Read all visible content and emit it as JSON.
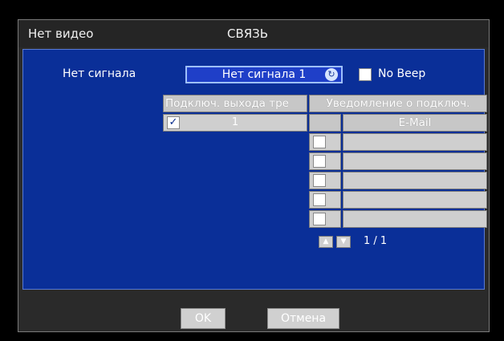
{
  "header": {
    "left_title": "Нет видео",
    "center_title": "СВЯЗЬ"
  },
  "signal": {
    "label": "Нет сигнала",
    "select_value": "Нет сигнала 1",
    "no_beep_label": "No Beep",
    "no_beep_checked": false
  },
  "output_table": {
    "header": "Подключ. выхода тре",
    "rows": [
      {
        "checked": true,
        "value": "1"
      }
    ]
  },
  "notify_table": {
    "header": "Уведомление о подключ.",
    "columns": [
      "",
      "E-Mail"
    ],
    "rows": [
      {
        "checked": false,
        "email": ""
      },
      {
        "checked": false,
        "email": ""
      },
      {
        "checked": false,
        "email": ""
      },
      {
        "checked": false,
        "email": ""
      },
      {
        "checked": false,
        "email": ""
      }
    ],
    "page": "1 / 1"
  },
  "footer": {
    "ok_label": "OK",
    "cancel_label": "Отмена"
  },
  "colors": {
    "panel": "#0a2f98",
    "select": "#1f3fc8",
    "frame": "#2a2a2a"
  },
  "icons": {
    "refresh": "refresh-icon",
    "up": "arrow-up-icon",
    "down": "arrow-down-icon"
  }
}
